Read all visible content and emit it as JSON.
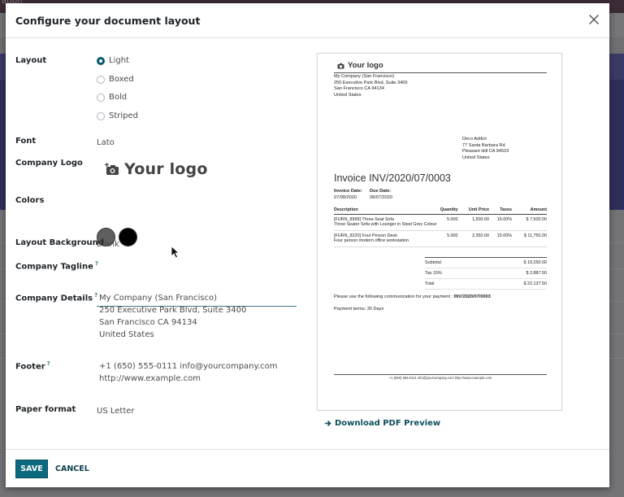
{
  "backdrop": {
    "app_text_fragment": "ation"
  },
  "dialog": {
    "title": "Configure your document layout",
    "close_icon": "close-icon"
  },
  "form": {
    "layout": {
      "label": "Layout",
      "options": [
        "Light",
        "Boxed",
        "Bold",
        "Striped"
      ],
      "selected": "Light"
    },
    "font": {
      "label": "Font",
      "value": "Lato"
    },
    "company_logo": {
      "label": "Company Logo",
      "placeholder": "Your logo",
      "icon": "camera-plus-icon"
    },
    "colors": {
      "label": "Colors",
      "primary": "#5f5f5f",
      "secondary": "#000000"
    },
    "layout_background": {
      "label": "Layout Background",
      "value": "Blank"
    },
    "company_tagline": {
      "label": "Company Tagline",
      "help": "?",
      "value": "",
      "placeholder": ""
    },
    "company_details": {
      "label": "Company Details",
      "help": "?",
      "lines": [
        "My Company (San Francisco)",
        "250 Executive Park Blvd, Suite 3400",
        "San Francisco CA 94134",
        "United States"
      ]
    },
    "footer": {
      "label": "Footer",
      "help": "?",
      "lines": [
        "+1 (650) 555-0111 info@yourcompany.com",
        "http://www.example.com"
      ]
    },
    "paper_format": {
      "label": "Paper format",
      "value": "US Letter"
    }
  },
  "preview": {
    "logo_text": "Your logo",
    "company_lines": [
      "My Company (San Francisco)",
      "250 Executive Park Blvd, Suite 3400",
      "San Francisco CA 94134",
      "United States"
    ],
    "customer_lines": [
      "Deco Addict",
      "77 Santa Barbara Rd",
      "Pleasant Hill CA 94523",
      "United States"
    ],
    "invoice_title": "Invoice INV/2020/07/0003",
    "invoice_date_label": "Invoice Date:",
    "invoice_date": "07/08/2020",
    "due_date_label": "Due Date:",
    "due_date": "08/07/2020",
    "columns": [
      "Description",
      "Quantity",
      "Unit Price",
      "Taxes",
      "Amount"
    ],
    "lines": [
      {
        "name": "[FURN_8999] Three-Seat Sofa",
        "desc": "Three Seater Sofa with Lounger in Steel Grey Colour",
        "qty": "5.000",
        "price": "1,500.00",
        "taxes": "15.00%",
        "amount": "$ 7,500.00"
      },
      {
        "name": "[FURN_8220] Four Person Desk",
        "desc": "Four person modern office workstation",
        "qty": "5.000",
        "price": "2,350.00",
        "taxes": "15.00%",
        "amount": "$ 11,750.00"
      }
    ],
    "totals": [
      {
        "label": "Subtotal",
        "value": "$ 19,250.00"
      },
      {
        "label": "Tax 15%",
        "value": "$ 2,887.50"
      },
      {
        "label": "Total",
        "value": "$ 22,137.50"
      }
    ],
    "payment_comm_text": "Please use the following communication for your payment : ",
    "payment_comm_ref": "INV/2020/07/0003",
    "payment_terms": "Payment terms: 30 Days",
    "footer_text": "+1 (650) 555-0111 info@yourcompany.com http://www.example.com"
  },
  "download_link": "Download PDF Preview",
  "buttons": {
    "save": "SAVE",
    "cancel": "CANCEL"
  }
}
